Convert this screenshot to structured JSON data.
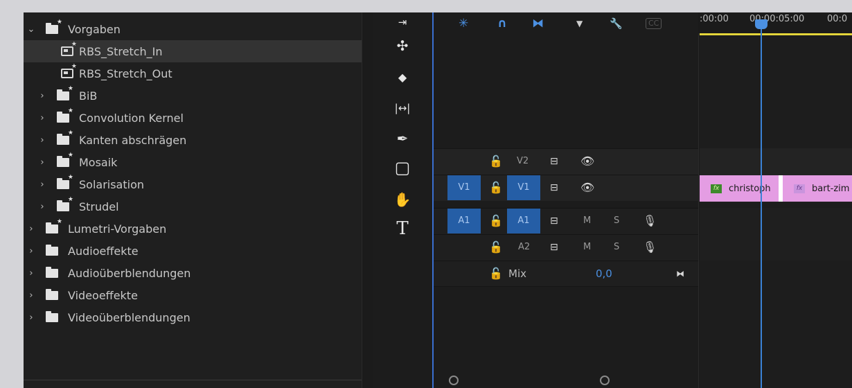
{
  "effects": {
    "items": [
      {
        "label": "Vorgaben",
        "chev": "⌄",
        "icon": "preset-folder-icon",
        "indent": 0
      },
      {
        "label": "RBS_Stretch_In",
        "chev": "",
        "icon": "preset-icon",
        "indent": 2
      },
      {
        "label": "RBS_Stretch_Out",
        "chev": "",
        "icon": "preset-icon",
        "indent": 2
      },
      {
        "label": "BiB",
        "chev": "›",
        "icon": "preset-folder-icon",
        "indent": 1
      },
      {
        "label": "Convolution Kernel",
        "chev": "›",
        "icon": "preset-folder-icon",
        "indent": 1
      },
      {
        "label": "Kanten abschrägen",
        "chev": "›",
        "icon": "preset-folder-icon",
        "indent": 1
      },
      {
        "label": "Mosaik",
        "chev": "›",
        "icon": "preset-folder-icon",
        "indent": 1
      },
      {
        "label": "Solarisation",
        "chev": "›",
        "icon": "preset-folder-icon",
        "indent": 1
      },
      {
        "label": "Strudel",
        "chev": "›",
        "icon": "preset-folder-icon",
        "indent": 1
      },
      {
        "label": "Lumetri-Vorgaben",
        "chev": "›",
        "icon": "preset-folder-icon",
        "indent": 0
      },
      {
        "label": "Audioeffekte",
        "chev": "›",
        "icon": "folder-icon",
        "indent": 0
      },
      {
        "label": "Audioüberblendungen",
        "chev": "›",
        "icon": "folder-icon",
        "indent": 0
      },
      {
        "label": "Videoeffekte",
        "chev": "›",
        "icon": "folder-icon",
        "indent": 0
      },
      {
        "label": "Videoüberblendungen",
        "chev": "›",
        "icon": "folder-icon",
        "indent": 0
      }
    ]
  },
  "tools": {
    "items": [
      {
        "name": "track-select-tool-icon",
        "glyph": "⇥"
      },
      {
        "name": "ripple-edit-tool-icon",
        "glyph": "✣"
      },
      {
        "name": "razor-tool-icon",
        "glyph": "◆"
      },
      {
        "name": "slip-tool-icon",
        "glyph": "|↔|"
      },
      {
        "name": "pen-tool-icon",
        "glyph": "✒"
      },
      {
        "name": "rectangle-tool-icon",
        "glyph": "▢"
      },
      {
        "name": "hand-tool-icon",
        "glyph": "✋"
      },
      {
        "name": "type-tool-icon",
        "glyph": "T"
      }
    ]
  },
  "timeline": {
    "toolbar_icons": [
      {
        "name": "snap-icon",
        "glyph": "✳",
        "color": "#4b90e2"
      },
      {
        "name": "magnet-icon",
        "glyph": "∩",
        "color": "#4b90e2"
      },
      {
        "name": "linked-selection-icon",
        "glyph": "⧓",
        "color": "#4b90e2"
      },
      {
        "name": "marker-icon",
        "glyph": "▼",
        "color": "#cfcfcf"
      },
      {
        "name": "wrench-icon",
        "glyph": "🔧",
        "color": "#cfcfcf"
      },
      {
        "name": "captions-icon",
        "glyph": "CC",
        "color": "#555555"
      }
    ],
    "ruler": {
      "left_time": ":00:00",
      "mid_time": "00:00:05:00",
      "right_time": "00:0"
    },
    "tracks": {
      "v2": {
        "target": "",
        "name": "V2"
      },
      "v1": {
        "target": "V1",
        "name": "V1"
      },
      "a1": {
        "target": "A1",
        "name": "A1",
        "mute": "M",
        "solo": "S"
      },
      "a2": {
        "target": "",
        "name": "A2",
        "mute": "M",
        "solo": "S"
      },
      "mix": {
        "name": "Mix",
        "value": "0,0"
      }
    },
    "clips": [
      {
        "label": "christoph",
        "fx": "fx"
      },
      {
        "label": "bart-zim",
        "fx": "fx"
      }
    ],
    "colors": {
      "clip": "#e49de3",
      "playhead": "#3b82d6",
      "target_on": "#255ea6",
      "work_area": "#e4d53a"
    }
  }
}
